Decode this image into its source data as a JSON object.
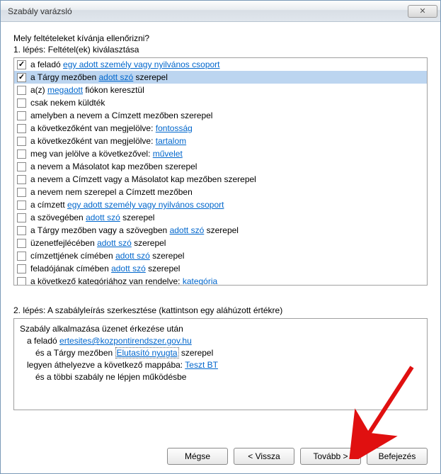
{
  "window": {
    "title": "Szabály varázsló",
    "close_glyph": "✕"
  },
  "prompt": "Mely feltételeket kívánja ellenőrizni?",
  "step1_label": "1. lépés: Feltétel(ek) kiválasztása",
  "conditions": [
    {
      "checked": true,
      "selected": false,
      "pre": "a feladó ",
      "link": "egy adott személy vagy nyilvános csoport",
      "post": ""
    },
    {
      "checked": true,
      "selected": true,
      "pre": "a Tárgy mezőben ",
      "link": "adott szó",
      "post": " szerepel"
    },
    {
      "checked": false,
      "selected": false,
      "pre": "a(z) ",
      "link": "megadott",
      "post": " fiókon keresztül"
    },
    {
      "checked": false,
      "selected": false,
      "pre": "csak nekem küldték",
      "link": "",
      "post": ""
    },
    {
      "checked": false,
      "selected": false,
      "pre": "amelyben a nevem a Címzett  mezőben szerepel",
      "link": "",
      "post": ""
    },
    {
      "checked": false,
      "selected": false,
      "pre": "a következőként van megjelölve: ",
      "link": "fontosság",
      "post": ""
    },
    {
      "checked": false,
      "selected": false,
      "pre": "a következőként van megjelölve: ",
      "link": "tartalom",
      "post": ""
    },
    {
      "checked": false,
      "selected": false,
      "pre": "meg van jelölve a következővel: ",
      "link": "művelet",
      "post": ""
    },
    {
      "checked": false,
      "selected": false,
      "pre": "a nevem a Másolatot kap mezőben szerepel",
      "link": "",
      "post": ""
    },
    {
      "checked": false,
      "selected": false,
      "pre": "a nevem a Címzett vagy a Másolatot kap mezőben szerepel",
      "link": "",
      "post": ""
    },
    {
      "checked": false,
      "selected": false,
      "pre": "a nevem nem szerepel a Címzett mezőben",
      "link": "",
      "post": ""
    },
    {
      "checked": false,
      "selected": false,
      "pre": "a címzett ",
      "link": "egy adott személy vagy nyilvános csoport",
      "post": ""
    },
    {
      "checked": false,
      "selected": false,
      "pre": "a szövegében ",
      "link": "adott szó",
      "post": " szerepel"
    },
    {
      "checked": false,
      "selected": false,
      "pre": "a Tárgy mezőben vagy a szövegben ",
      "link": "adott szó",
      "post": " szerepel"
    },
    {
      "checked": false,
      "selected": false,
      "pre": "üzenetfejlécében ",
      "link": "adott szó",
      "post": " szerepel"
    },
    {
      "checked": false,
      "selected": false,
      "pre": "címzettjének címében ",
      "link": "adott szó",
      "post": " szerepel"
    },
    {
      "checked": false,
      "selected": false,
      "pre": "feladójának címében ",
      "link": "adott szó",
      "post": " szerepel"
    },
    {
      "checked": false,
      "selected": false,
      "pre": "a következő kategóriához van rendelve: ",
      "link": "kategória",
      "post": ""
    }
  ],
  "step2_label": "2. lépés: A szabályleírás szerkesztése (kattintson egy aláhúzott értékre)",
  "description": {
    "line1": "Szabály alkalmazása üzenet érkezése után",
    "line2_pre": "a feladó ",
    "line2_link": "ertesites@kozpontirendszer.gov.hu",
    "line3_pre": "és a Tárgy mezőben ",
    "line3_link": "Elutasító nyugta",
    "line3_post": " szerepel",
    "line4_pre": "legyen áthelyezve a következő mappába: ",
    "line4_link": "Teszt BT",
    "line5": "és a többi szabály ne lépjen működésbe"
  },
  "buttons": {
    "cancel": "Mégse",
    "back": "< Vissza",
    "next": "Tovább >",
    "finish": "Befejezés"
  }
}
